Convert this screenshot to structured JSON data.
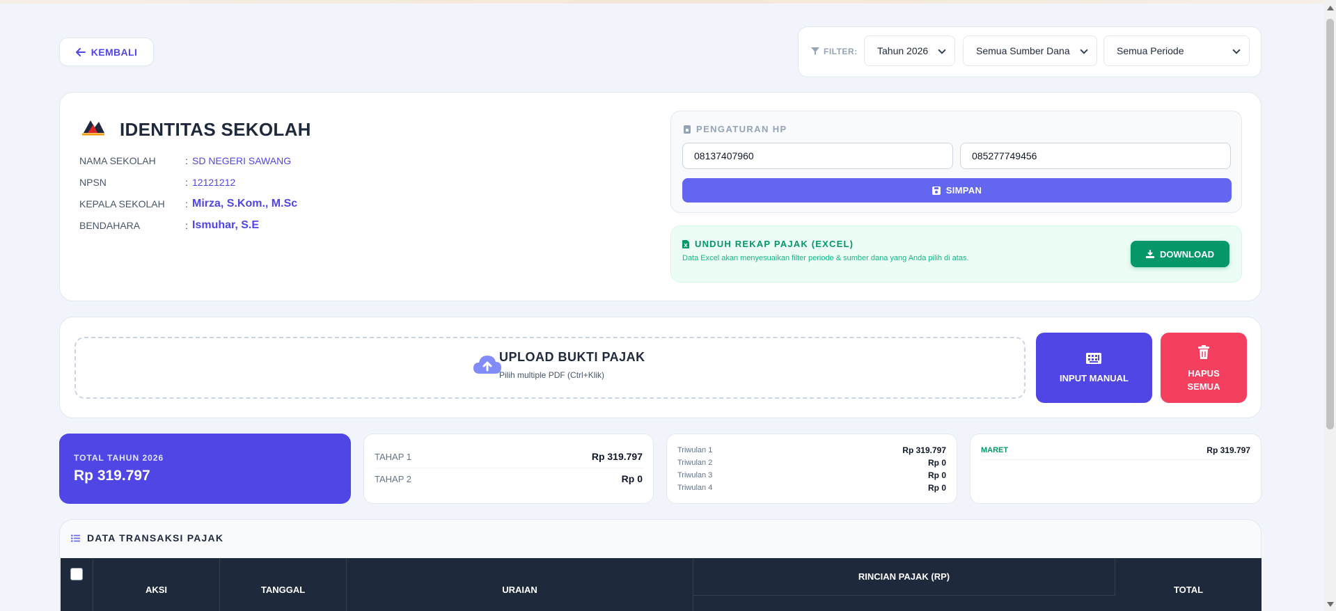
{
  "back_label": "KEMBALI",
  "filter": {
    "label": "FILTER:",
    "year": "Tahun 2026",
    "source": "Semua Sumber Dana",
    "period": "Semua Periode"
  },
  "identity": {
    "title": "IDENTITAS SEKOLAH",
    "rows": [
      {
        "label": "NAMA SEKOLAH",
        "value": "SD NEGERI SAWANG"
      },
      {
        "label": "NPSN",
        "value": "12121212"
      },
      {
        "label": "KEPALA SEKOLAH",
        "value": "Mirza, S.Kom., M.Sc"
      },
      {
        "label": "BENDAHARA",
        "value": "Ismuhar, S.E"
      }
    ]
  },
  "hp": {
    "title": "PENGATURAN HP",
    "phone1": "08137407960",
    "phone2": "085277749456",
    "save_label": "SIMPAN"
  },
  "excel": {
    "title": "UNDUH REKAP PAJAK (EXCEL)",
    "desc": "Data Excel akan menyesuaikan filter periode & sumber dana yang Anda pilih di atas.",
    "download_label": "DOWNLOAD"
  },
  "upload": {
    "title": "UPLOAD BUKTI PAJAK",
    "desc": "Pilih multiple PDF (Ctrl+Klik)",
    "manual_label": "INPUT MANUAL",
    "delete_label_1": "HAPUS",
    "delete_label_2": "SEMUA"
  },
  "summary": {
    "total_label": "TOTAL TAHUN 2026",
    "total_value": "Rp 319.797",
    "tahap": [
      {
        "label": "TAHAP 1",
        "value": "Rp 319.797"
      },
      {
        "label": "TAHAP 2",
        "value": "Rp 0"
      }
    ],
    "triwulan": [
      {
        "label": "Triwulan 1",
        "value": "Rp 319.797"
      },
      {
        "label": "Triwulan 2",
        "value": "Rp 0"
      },
      {
        "label": "Triwulan 3",
        "value": "Rp 0"
      },
      {
        "label": "Triwulan 4",
        "value": "Rp 0"
      }
    ],
    "month": {
      "label": "MARET",
      "value": "Rp 319.797"
    }
  },
  "table": {
    "title": "DATA TRANSAKSI PAJAK",
    "headers": {
      "aksi": "AKSI",
      "tanggal": "TANGGAL",
      "uraian": "URAIAN",
      "rincian": "RINCIAN PAJAK (RP)",
      "total": "TOTAL"
    }
  },
  "colors": {
    "primary": "#4f46e5",
    "accent": "#6366f1",
    "success": "#059669",
    "danger": "#f43f5e",
    "header_dark": "#1e293b"
  }
}
